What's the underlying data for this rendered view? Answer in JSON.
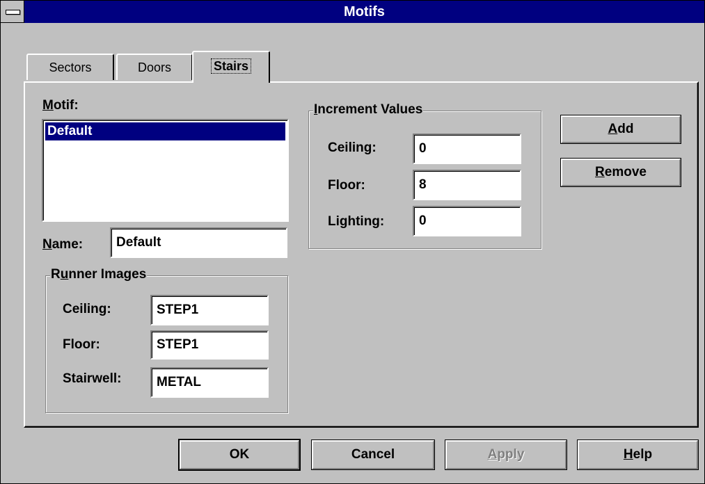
{
  "window": {
    "title": "Motifs"
  },
  "tabs": [
    "Sectors",
    "Doors",
    "Stairs"
  ],
  "motif": {
    "label_prefix": "",
    "label_ul": "M",
    "label_rest": "otif:",
    "items": [
      "Default"
    ]
  },
  "name": {
    "label_ul": "N",
    "label_rest": "ame:",
    "value": "Default"
  },
  "runner": {
    "legend_pre": "R",
    "legend_ul": "u",
    "legend_rest": "nner Images",
    "ceiling_label": "Ceiling:",
    "ceiling_value": "STEP1",
    "floor_label": "Floor:",
    "floor_value": "STEP1",
    "stairwell_label": "Stairwell:",
    "stairwell_value": "METAL"
  },
  "increment": {
    "legend_ul": "I",
    "legend_rest": "ncrement Values",
    "ceiling_label": "Ceiling:",
    "ceiling_value": "0",
    "floor_label": "Floor:",
    "floor_value": "8",
    "lighting_label": "Lighting:",
    "lighting_value": "0"
  },
  "buttons": {
    "add_ul": "A",
    "add_rest": "dd",
    "remove_ul": "R",
    "remove_rest": "emove",
    "ok": "OK",
    "cancel": "Cancel",
    "apply_ul": "A",
    "apply_rest": "pply",
    "help_ul": "H",
    "help_rest": "elp"
  }
}
